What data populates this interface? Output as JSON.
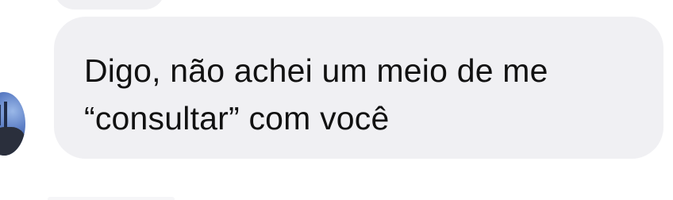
{
  "messages": [
    {
      "text": "Digo, não achei um meio de me\n“consultar” com você"
    }
  ],
  "colors": {
    "bubble_background": "#f0f0f3",
    "text": "#111111",
    "page_background": "#ffffff"
  },
  "icons": {
    "sender_avatar": "avatar-photo"
  }
}
